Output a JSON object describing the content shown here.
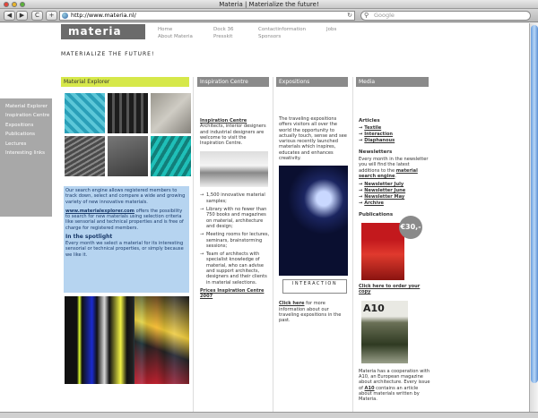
{
  "window": {
    "title": "Materia | Materialize the future!"
  },
  "toolbar": {
    "back": "◀",
    "forward": "▶",
    "reload": "C",
    "add": "+",
    "url": "http://www.materia.nl/",
    "search_placeholder": "Google"
  },
  "logo": "materia",
  "topnav": [
    "Home",
    "About Materia",
    "Dock 36",
    "Presskit",
    "Contactinformation",
    "Sponsors",
    "Jobs"
  ],
  "tagline": "MATERIALIZE THE FUTURE!",
  "sidebar": [
    "Material Explorer",
    "Inspiration Centre",
    "Expositions",
    "Publications",
    "Lectures",
    "Interesting links"
  ],
  "columns": [
    "Material Explorer",
    "Inspiration Centre",
    "Expositions",
    "Media"
  ],
  "material_explorer": {
    "p1": "Our search engine allows registered members to track down, select and compare a wide and growing variety of new innovative materials.",
    "link": "www.materialexplorer.com",
    "p2": " offers the possibility to search for new materials using selection criteria like sensorial and technical properties and is free of charge for registered members.",
    "spotlight_title": "In the spotlight",
    "spotlight_text": "Every month we select a material for its interesting sensorial or technical properties, or simply because we like it."
  },
  "inspiration": {
    "title": "Inspiration Centre",
    "intro": "Architects, interior designers and industrial designers are welcome to visit the Inspiration Centre.",
    "bullets": [
      "1,500 innovative material samples;",
      "Library with no fewer than 750 books and magazines on material, architecture and design;",
      "Meeting rooms for lectures, seminars, brainstorming sessions;",
      "Team of architects with specialist knowledge of material, who can advise and support architects, designers and their clients in material selections."
    ],
    "prices_link": "Prices Inspiration Centre 2007"
  },
  "expositions": {
    "intro": "The traveling expositions offers visitors all over the world the opportunity to actually touch, sense and see various recently launched materials which inspires, educates and enhances creativity.",
    "logo_text": "INTERACTION",
    "click_here": "Click here",
    "more": " for more information about our traveling expositions in the past."
  },
  "media": {
    "articles_title": "Articles",
    "articles": [
      "Textile",
      "Interaction",
      "Diaphanous"
    ],
    "newsletters_title": "Newsletters",
    "newsletters_text": "Every month in the newsletter you will find the latest additions to the ",
    "engine_link": "material search engine",
    "newsletters": [
      "Newsletter July",
      "Newsletter June",
      "Newsletter May",
      "Archive"
    ],
    "publications_title": "Publications",
    "price_badge": "€30,-",
    "order_link": "Click here to order your copy",
    "a10_cover": "A10",
    "cooperation_1": "Materia has a cooperation with A10, an European magazine about architecture. Every issue of ",
    "a10_link": "A10",
    "cooperation_2": " contains an article about materials written by Materia."
  }
}
